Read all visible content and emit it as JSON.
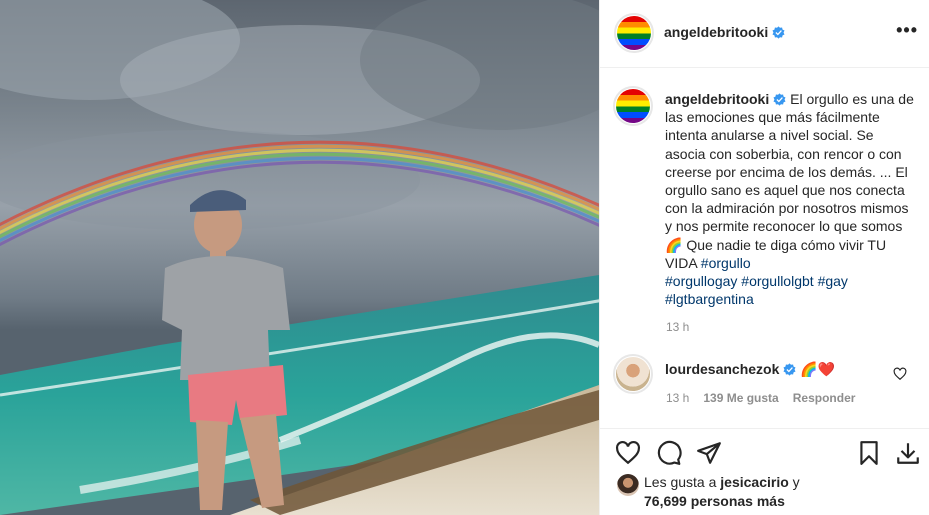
{
  "post": {
    "username": "angeldebritooki",
    "caption_parts": [
      "El orgullo es una de las emociones que más fácilmente intenta anularse a nivel social. Se asocia con soberbia, con rencor o con creerse por encima de los demás. ... El orgullo sano es aquel que nos conecta con la admiración por nosotros mismos y nos permite reconocer lo que somos",
      "🌈",
      " Que nadie te diga cómo vivir TU VIDA "
    ],
    "hashtags": [
      "#orgullo",
      "#orgullogay",
      "#orgullolgbt",
      "#gay",
      "#lgtbargentina"
    ],
    "time": "13 h"
  },
  "comment": {
    "username": "lourdesanchezok",
    "text": "🌈❤️",
    "time": "13 h",
    "likes": "139 Me gusta",
    "reply": "Responder"
  },
  "likes": {
    "prefix": "Les gusta a ",
    "user": "jesicacirio",
    "suffix": " y",
    "count": "76,699 personas más"
  },
  "icons": [
    "more-options-icon",
    "verified-badge-icon",
    "heart-icon",
    "comment-icon",
    "share-icon",
    "bookmark-icon",
    "download-icon"
  ],
  "colors": {
    "link": "#00376b",
    "verified": "#3897f0",
    "muted": "#8e8e8e",
    "text": "#262626"
  }
}
